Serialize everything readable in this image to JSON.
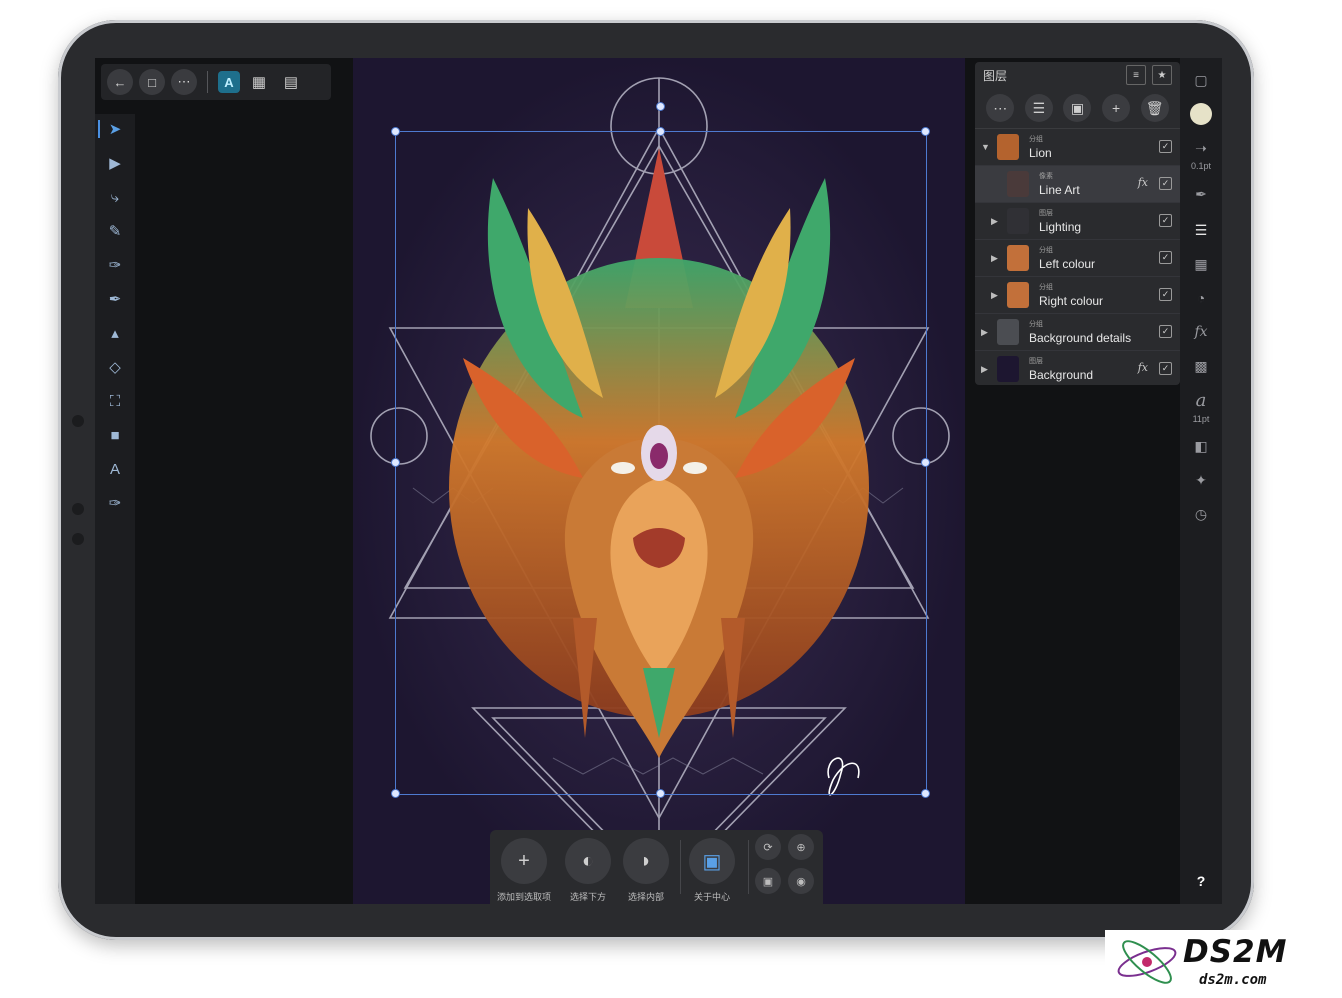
{
  "topbar": {
    "back_icon": "arrow-left-icon",
    "document_icon": "document-icon",
    "more_icon": "ellipsis-icon",
    "persona_icon": "designer-persona-icon",
    "grid_icon": "pixel-grid-icon",
    "export_icon": "export-persona-icon"
  },
  "tools": [
    {
      "name": "move-tool-icon"
    },
    {
      "name": "node-tool-icon"
    },
    {
      "name": "corner-tool-icon"
    },
    {
      "name": "pencil-tool-icon"
    },
    {
      "name": "vector-brush-tool-icon"
    },
    {
      "name": "pen-tool-icon"
    },
    {
      "name": "fill-tool-icon"
    },
    {
      "name": "transparency-tool-icon"
    },
    {
      "name": "crop-tool-icon"
    },
    {
      "name": "rectangle-tool-icon"
    },
    {
      "name": "text-tool-icon"
    },
    {
      "name": "color-picker-tool-icon"
    }
  ],
  "layers_panel": {
    "title": "图层",
    "rows": [
      {
        "type": "分组",
        "name": "Lion",
        "fx": "",
        "thumb": "#b4632e"
      },
      {
        "type": "像素",
        "name": "Line Art",
        "fx": "fx",
        "thumb": "#4a3a3a"
      },
      {
        "type": "图层",
        "name": "Lighting",
        "fx": "",
        "thumb": "#303035"
      },
      {
        "type": "分组",
        "name": "Left colour",
        "fx": "",
        "thumb": "#c2703a"
      },
      {
        "type": "分组",
        "name": "Right colour",
        "fx": "",
        "thumb": "#c2703a"
      },
      {
        "type": "分组",
        "name": "Background details",
        "fx": "",
        "thumb": "#4b4d52"
      },
      {
        "type": "图层",
        "name": "Background",
        "fx": "fx",
        "thumb": "#1d1630"
      }
    ]
  },
  "right_sidebar": {
    "stroke_width": "0.1pt",
    "font_size": "11pt",
    "font_glyph": "a",
    "help": "?"
  },
  "context_bar": {
    "add_label": "添加到选取项",
    "below_label": "选择下方",
    "inside_label": "选择内部",
    "center_label": "关于中心"
  },
  "watermark": {
    "brand": "DS2M",
    "site": "ds2m.com"
  },
  "colors": {
    "canvas_bg": "#1d1630",
    "selection": "#4e7ad0",
    "accent": "#4a90e2"
  }
}
